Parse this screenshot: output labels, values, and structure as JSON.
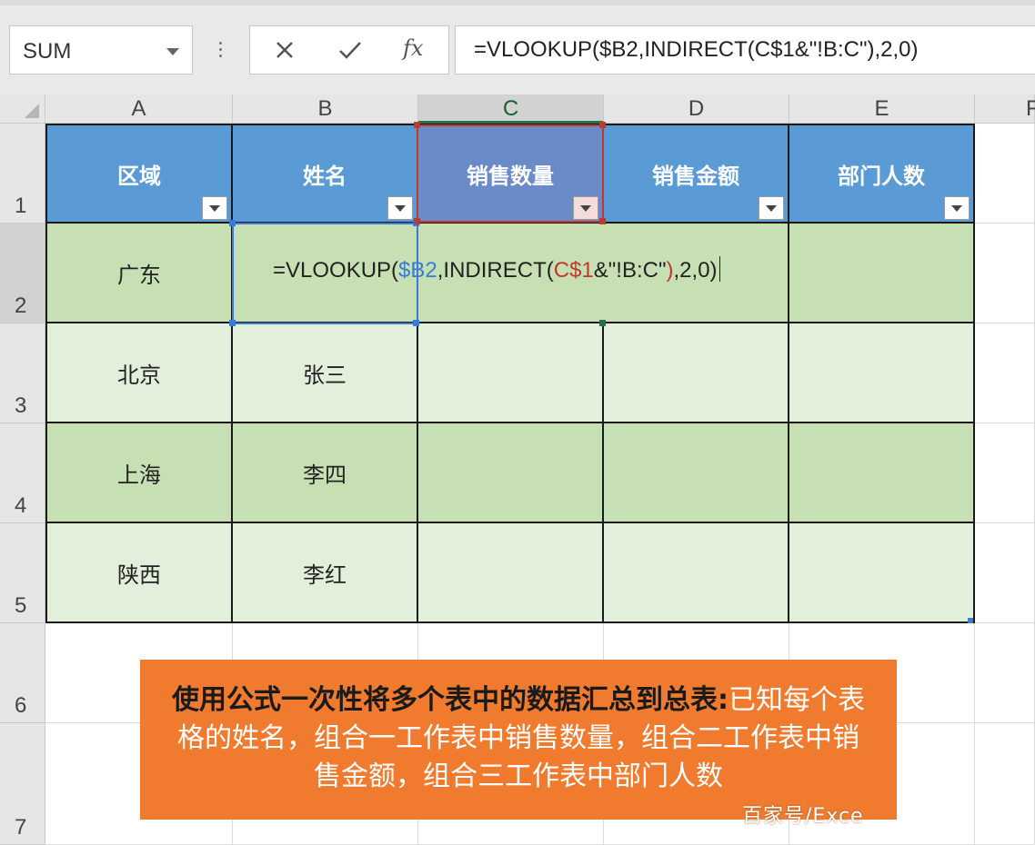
{
  "formula_bar": {
    "name_box": "SUM",
    "fx_label": "fx",
    "formula": "=VLOOKUP($B2,INDIRECT(C$1&\"!B:C\"),2,0)"
  },
  "columns": [
    "A",
    "B",
    "C",
    "D",
    "E",
    "F"
  ],
  "rows": [
    "1",
    "2",
    "3",
    "4",
    "5",
    "6",
    "7"
  ],
  "headers": [
    "区域",
    "姓名",
    "销售数量",
    "销售金额",
    "部门人数"
  ],
  "data_rows": [
    {
      "region": "广东",
      "name": ""
    },
    {
      "region": "北京",
      "name": "张三"
    },
    {
      "region": "上海",
      "name": "李四"
    },
    {
      "region": "陕西",
      "name": "李红"
    }
  ],
  "edit": {
    "prefix": "=VLOOKUP(",
    "ref1": "$B2",
    "mid": ",INDIRECT(",
    "ref2": "C$1",
    "suffix_a": "&\"!B:C\"",
    "ref2_close": ")",
    "suffix_b": ",2,0)"
  },
  "caption": {
    "bold": "使用公式一次性将多个表中的数据汇总到总表:",
    "rest": "已知每个表格的姓名，组合一工作表中销售数量，组合二工作表中销售金额，组合三工作表中部门人数"
  },
  "watermark": "百家号/Exce"
}
